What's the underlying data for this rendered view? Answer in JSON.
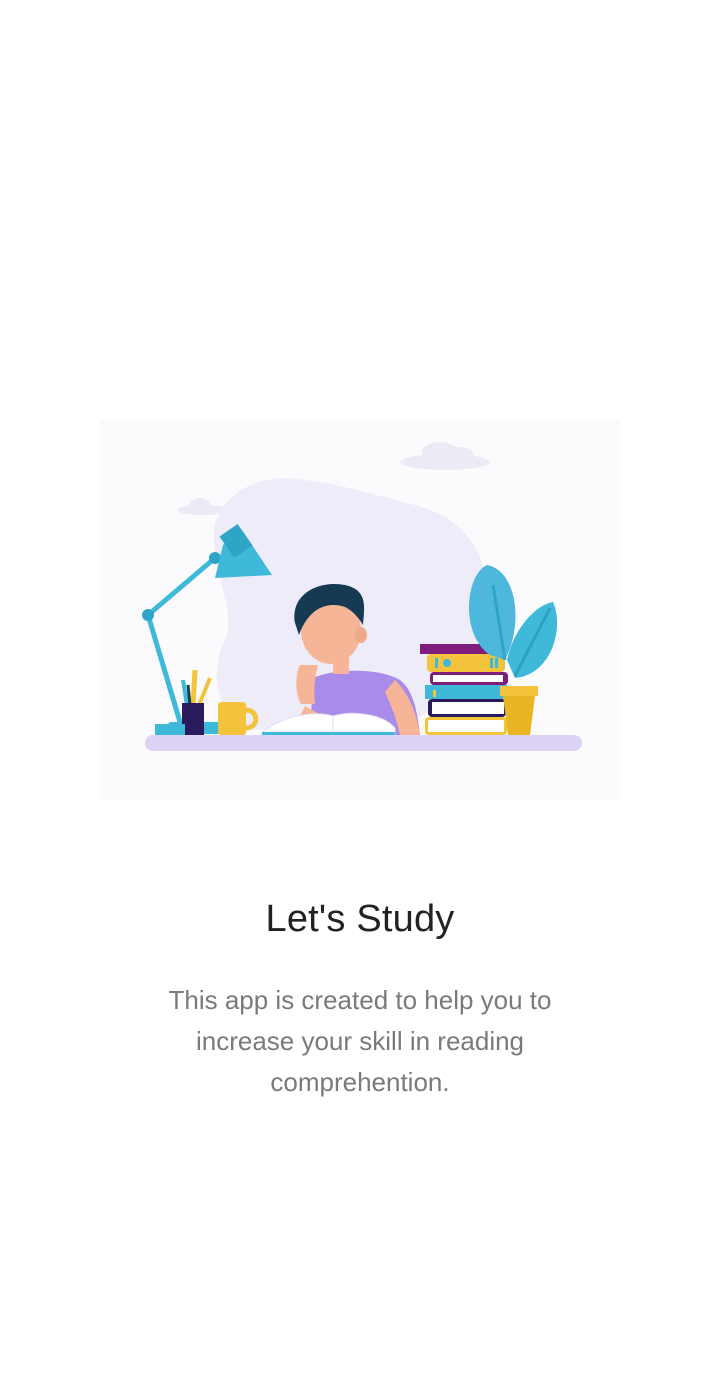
{
  "onboarding": {
    "illustration_icon": "student-studying-illustration",
    "title": "Let's Study",
    "description": "This app is created to help you to increase your skill in reading comprehention."
  },
  "colors": {
    "background": "#ffffff",
    "title": "#222222",
    "description": "#7a7a7a",
    "lamp": "#3fb9d9",
    "desk": "#ddd3f5",
    "shirt": "#a98bea",
    "hair": "#163a52",
    "skin": "#f5b596",
    "plant": "#4eb8dc",
    "pot": "#f3c33b"
  }
}
